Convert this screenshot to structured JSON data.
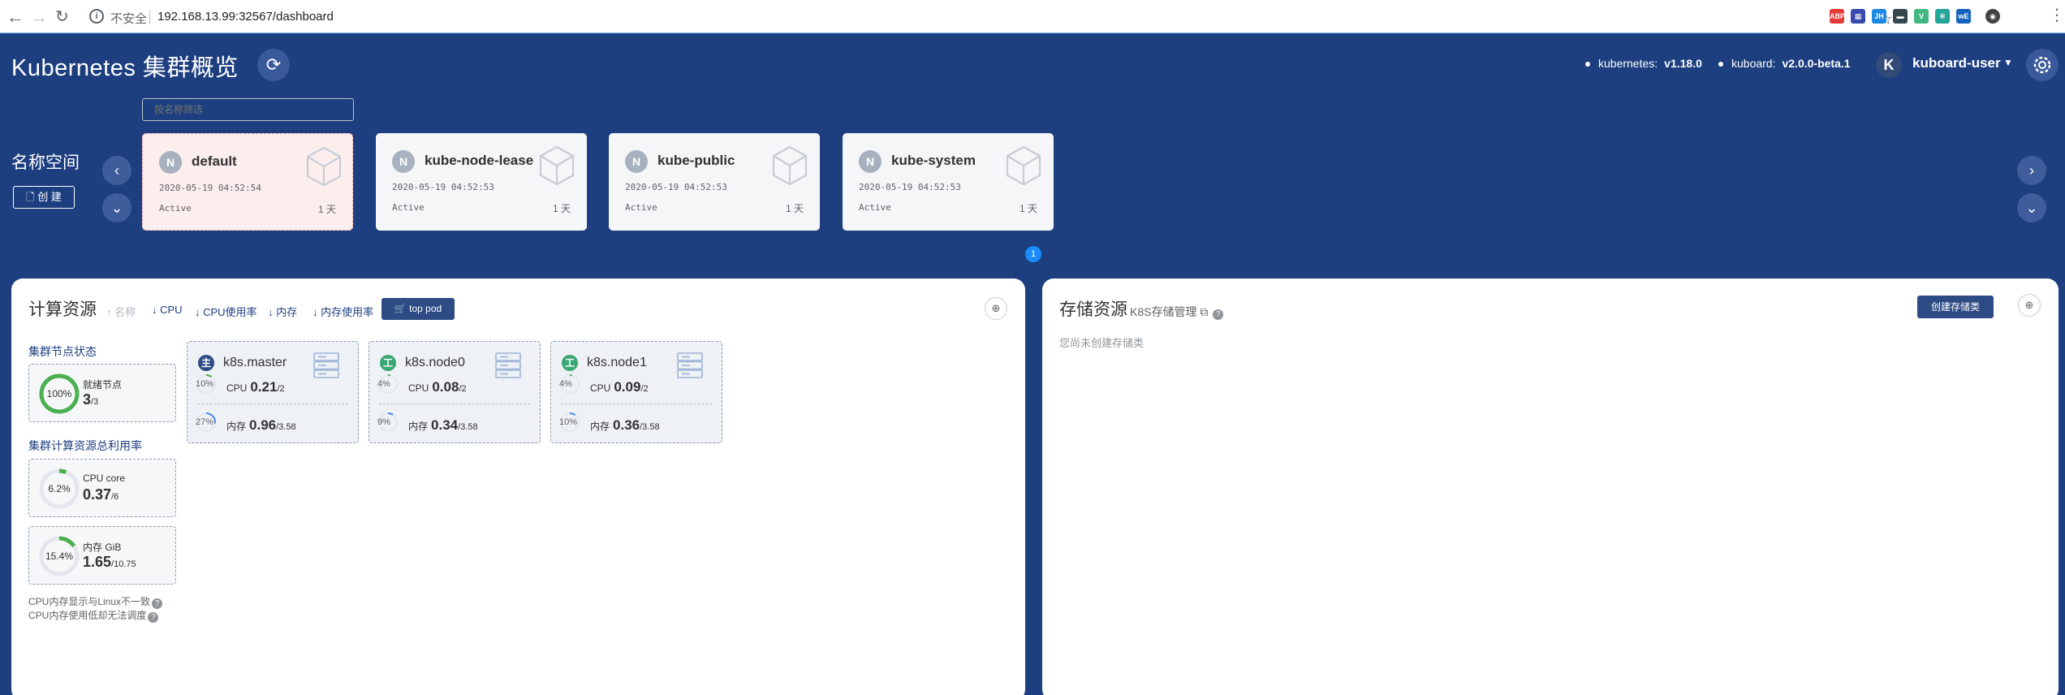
{
  "browser": {
    "insecure_label": "不安全",
    "url": "192.168.13.99:32567/dashboard",
    "extensions": [
      {
        "name": "abp-icon",
        "label": "ABP",
        "color": "#e53935"
      },
      {
        "name": "calendar-icon",
        "label": "▦",
        "color": "#3949ab"
      },
      {
        "name": "jh-icon",
        "label": "JH",
        "color": "#1e88e5"
      },
      {
        "name": "terminal-icon",
        "label": "▬",
        "color": "#37474f"
      },
      {
        "name": "vue-icon",
        "label": "V",
        "color": "#41b883"
      },
      {
        "name": "spark-icon",
        "label": "✻",
        "color": "#26a69a"
      },
      {
        "name": "wk-icon",
        "label": "wE",
        "color": "#1565c0"
      },
      {
        "name": "profile-avatar-icon",
        "label": "◉",
        "color": "#424242"
      }
    ]
  },
  "header": {
    "title": "Kubernetes 集群概览",
    "kubernetes_label": "kubernetes:",
    "kubernetes_version": "v1.18.0",
    "kuboard_label": "kuboard:",
    "kuboard_version": "v2.0.0-beta.1",
    "avatar_letter": "K",
    "user": "kuboard-user"
  },
  "namespaces": {
    "section_label": "名称空间",
    "create_label": "创 建",
    "filter_placeholder": "按名称筛选",
    "page": "1",
    "items": [
      {
        "badge": "N",
        "name": "default",
        "created": "2020-05-19 04:52:54",
        "status": "Active",
        "age": "1 天",
        "active": true
      },
      {
        "badge": "N",
        "name": "kube-node-lease",
        "created": "2020-05-19 04:52:53",
        "status": "Active",
        "age": "1 天",
        "active": false
      },
      {
        "badge": "N",
        "name": "kube-public",
        "created": "2020-05-19 04:52:53",
        "status": "Active",
        "age": "1 天",
        "active": false
      },
      {
        "badge": "N",
        "name": "kube-system",
        "created": "2020-05-19 04:52:53",
        "status": "Active",
        "age": "1 天",
        "active": false
      }
    ]
  },
  "compute": {
    "title": "计算资源",
    "sort": {
      "name": "↑ 名称",
      "cpu": "↓ CPU",
      "cpu_usage": "↓ CPU使用率",
      "memory": "↓ 内存",
      "memory_usage": "↓ 内存使用率"
    },
    "top_pod_label": "top pod",
    "node_status_label": "集群节点状态",
    "ready_nodes": {
      "label": "就绪节点",
      "percent_text": "100%",
      "ratio": 1.0,
      "value": "3",
      "total": "/3"
    },
    "utilization_label": "集群计算资源总利用率",
    "cpu_core": {
      "label": "CPU core",
      "percent_text": "6.2%",
      "ratio": 0.062,
      "value": "0.37",
      "total": "/6"
    },
    "memory_gib": {
      "label": "内存 GiB",
      "percent_text": "15.4%",
      "ratio": 0.154,
      "value": "1.65",
      "total": "/10.75"
    },
    "note1": "CPU内存显示与Linux不一致",
    "note2": "CPU内存使用低却无法调度",
    "nodes": [
      {
        "role": "主",
        "role_color": "#2d4b85",
        "name": "k8s.master",
        "cpu_pct": "10%",
        "cpu_ratio": 0.1,
        "cpu_label": "CPU",
        "cpu_val": "0.21",
        "cpu_total": "/2",
        "mem_pct": "27%",
        "mem_ratio": 0.27,
        "mem_label": "内存",
        "mem_val": "0.96",
        "mem_total": "/3.58"
      },
      {
        "role": "工",
        "role_color": "#3aa776",
        "name": "k8s.node0",
        "cpu_pct": "4%",
        "cpu_ratio": 0.04,
        "cpu_label": "CPU",
        "cpu_val": "0.08",
        "cpu_total": "/2",
        "mem_pct": "9%",
        "mem_ratio": 0.09,
        "mem_label": "内存",
        "mem_val": "0.34",
        "mem_total": "/3.58"
      },
      {
        "role": "工",
        "role_color": "#3aa776",
        "name": "k8s.node1",
        "cpu_pct": "4%",
        "cpu_ratio": 0.04,
        "cpu_label": "CPU",
        "cpu_val": "0.09",
        "cpu_total": "/2",
        "mem_pct": "10%",
        "mem_ratio": 0.1,
        "mem_label": "内存",
        "mem_val": "0.36",
        "mem_total": "/3.58"
      }
    ]
  },
  "storage": {
    "title": "存储资源",
    "link": "K8S存储管理",
    "create_label": "创建存储类",
    "empty_text": "您尚未创建存储类"
  }
}
